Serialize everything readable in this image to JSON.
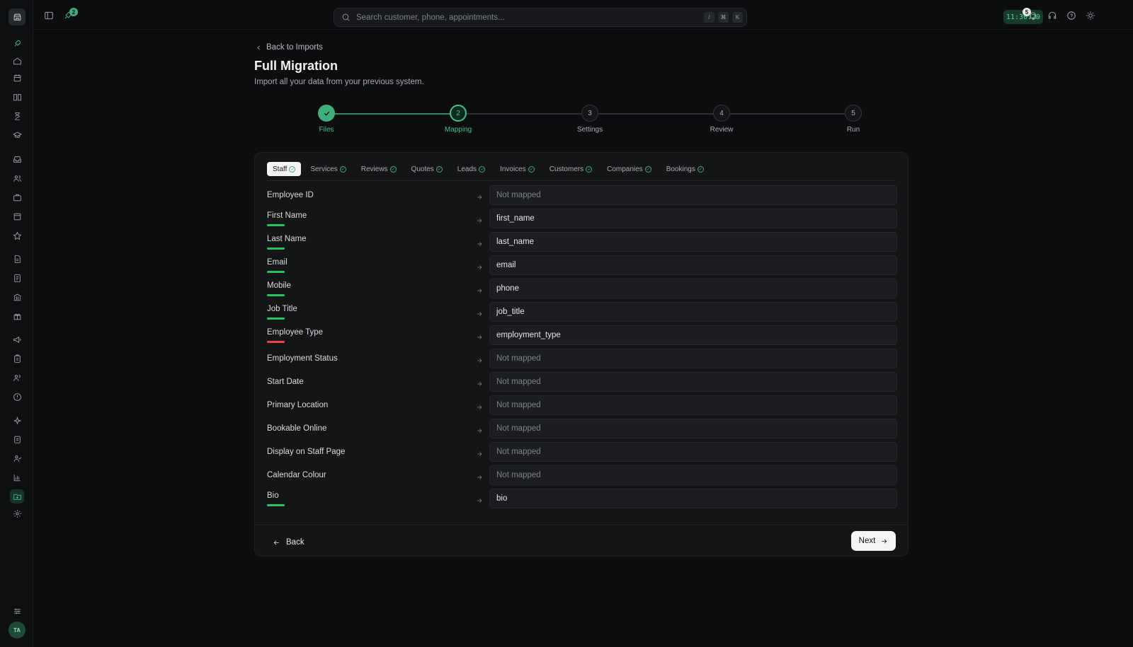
{
  "topbar": {
    "search_placeholder": "Search customer, phone, appointments...",
    "shortcut_keys": [
      "/",
      "⌘",
      "K"
    ],
    "clock": "11:30:29",
    "notification_count": "5",
    "activity_count": "2"
  },
  "header": {
    "back_label": "Back to Imports",
    "title": "Full Migration",
    "subtitle": "Import all your data from your previous system."
  },
  "stepper": {
    "steps": [
      {
        "number": "",
        "label": "Files",
        "state": "done"
      },
      {
        "number": "2",
        "label": "Mapping",
        "state": "current"
      },
      {
        "number": "3",
        "label": "Settings",
        "state": "upcoming"
      },
      {
        "number": "4",
        "label": "Review",
        "state": "upcoming"
      },
      {
        "number": "5",
        "label": "Run",
        "state": "upcoming"
      }
    ]
  },
  "tabs": [
    {
      "label": "Staff",
      "active": true
    },
    {
      "label": "Services",
      "active": false
    },
    {
      "label": "Reviews",
      "active": false
    },
    {
      "label": "Quotes",
      "active": false
    },
    {
      "label": "Leads",
      "active": false
    },
    {
      "label": "Invoices",
      "active": false
    },
    {
      "label": "Customers",
      "active": false
    },
    {
      "label": "Companies",
      "active": false
    },
    {
      "label": "Bookings",
      "active": false
    }
  ],
  "mapping": [
    {
      "field": "Employee ID",
      "value": "Not mapped",
      "mapped": false,
      "indicator": "none"
    },
    {
      "field": "First Name",
      "value": "first_name",
      "mapped": true,
      "indicator": "green"
    },
    {
      "field": "Last Name",
      "value": "last_name",
      "mapped": true,
      "indicator": "green"
    },
    {
      "field": "Email",
      "value": "email",
      "mapped": true,
      "indicator": "green"
    },
    {
      "field": "Mobile",
      "value": "phone",
      "mapped": true,
      "indicator": "green"
    },
    {
      "field": "Job Title",
      "value": "job_title",
      "mapped": true,
      "indicator": "green"
    },
    {
      "field": "Employee Type",
      "value": "employment_type",
      "mapped": true,
      "indicator": "red"
    },
    {
      "field": "Employment Status",
      "value": "Not mapped",
      "mapped": false,
      "indicator": "none"
    },
    {
      "field": "Start Date",
      "value": "Not mapped",
      "mapped": false,
      "indicator": "none"
    },
    {
      "field": "Primary Location",
      "value": "Not mapped",
      "mapped": false,
      "indicator": "none"
    },
    {
      "field": "Bookable Online",
      "value": "Not mapped",
      "mapped": false,
      "indicator": "none"
    },
    {
      "field": "Display on Staff Page",
      "value": "Not mapped",
      "mapped": false,
      "indicator": "none"
    },
    {
      "field": "Calendar Colour",
      "value": "Not mapped",
      "mapped": false,
      "indicator": "none"
    },
    {
      "field": "Bio",
      "value": "bio",
      "mapped": true,
      "indicator": "green"
    }
  ],
  "footer": {
    "back_label": "Back",
    "next_label": "Next"
  },
  "user": {
    "initials": "TA"
  },
  "colors": {
    "accent": "#46c28a",
    "ok": "#22c55e",
    "warn": "#ef4444"
  }
}
